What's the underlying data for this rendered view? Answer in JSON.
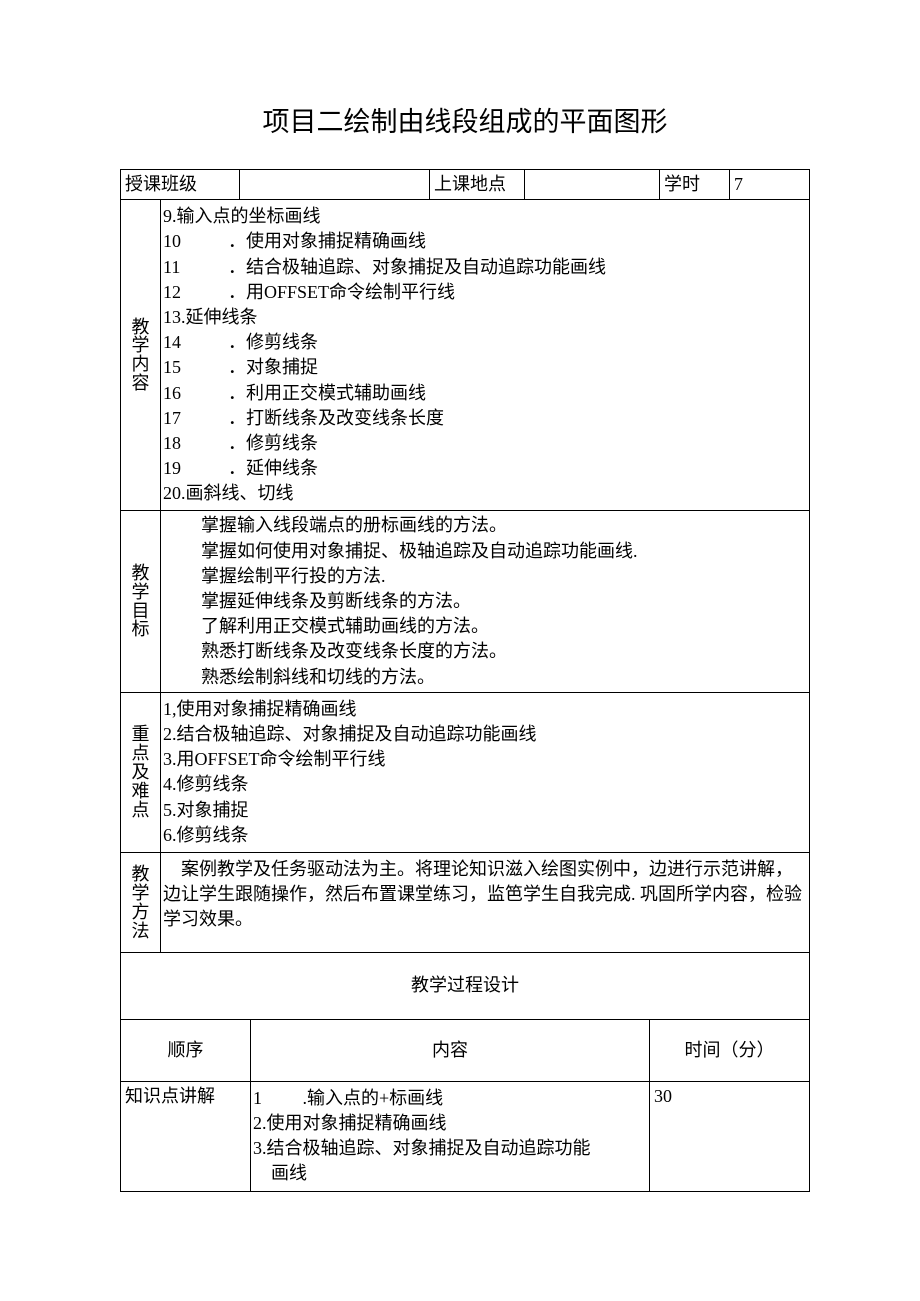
{
  "title": "项目二绘制由线段组成的平面图形",
  "header": {
    "class_label": "授课班级",
    "class_value": "",
    "location_label": "上课地点",
    "location_value": "",
    "hours_label": "学时",
    "hours_value": "7"
  },
  "teaching_content": {
    "label": "教学内容",
    "items": [
      {
        "num": "9.",
        "text": "输入点的坐标画线"
      },
      {
        "num": "10",
        "text": "．使用对象捕捉精确画线"
      },
      {
        "num": "11",
        "text": "．结合极轴追踪、对象捕捉及自动追踪功能画线"
      },
      {
        "num": "12",
        "text": "．用OFFSET命令绘制平行线"
      },
      {
        "num": "13.",
        "text": "延伸线条"
      },
      {
        "num": "14",
        "text": "．修剪线条"
      },
      {
        "num": "15",
        "text": "．对象捕捉"
      },
      {
        "num": "16",
        "text": "．利用正交模式辅助画线"
      },
      {
        "num": "17",
        "text": "．打断线条及改变线条长度"
      },
      {
        "num": "18",
        "text": "．修剪线条"
      },
      {
        "num": "19",
        "text": "．延伸线条"
      },
      {
        "num": "20.",
        "text": "画斜线、切线"
      }
    ]
  },
  "teaching_goals": {
    "label": "教学目标",
    "items": [
      "掌握输入线段端点的册标画线的方法。",
      "掌握如何使用对象捕捉、极轴追踪及自动追踪功能画线.",
      "掌握绘制平行投的方法.",
      "掌握延伸线条及剪断线条的方法。",
      "了解利用正交模式辅助画线的方法。",
      "熟悉打断线条及改变线条长度的方法。",
      "熟悉绘制斜线和切线的方法。"
    ]
  },
  "key_difficulties": {
    "label": "重点及难点",
    "items": [
      "1,使用对象捕捉精确画线",
      "2.结合极轴追踪、对象捕捉及自动追踪功能画线",
      "3.用OFFSET命令绘制平行线",
      "4.修剪线条",
      "5.对象捕捉",
      "6.修剪线条"
    ]
  },
  "teaching_methods": {
    "label": "教学方法",
    "text": "　案例教学及任务驱动法为主。将理论知识滋入绘图实例中，边进行示范讲解，边让学生跟随操作，然后布置课堂练习，监笆学生自我完成. 巩固所学内容，检验学习效果。"
  },
  "process_design": {
    "title": "教学过程设计",
    "col_order": "顺序",
    "col_content": "内容",
    "col_time": "时间（分）",
    "rows": [
      {
        "order": "知识点讲解",
        "content_lines": [
          "1         .输入点的+标画线",
          "2.使用对象捕捉精确画线",
          "3.结合极轴追踪、对象捕捉及自动追踪功能",
          "　画线"
        ],
        "time": "30"
      }
    ]
  }
}
